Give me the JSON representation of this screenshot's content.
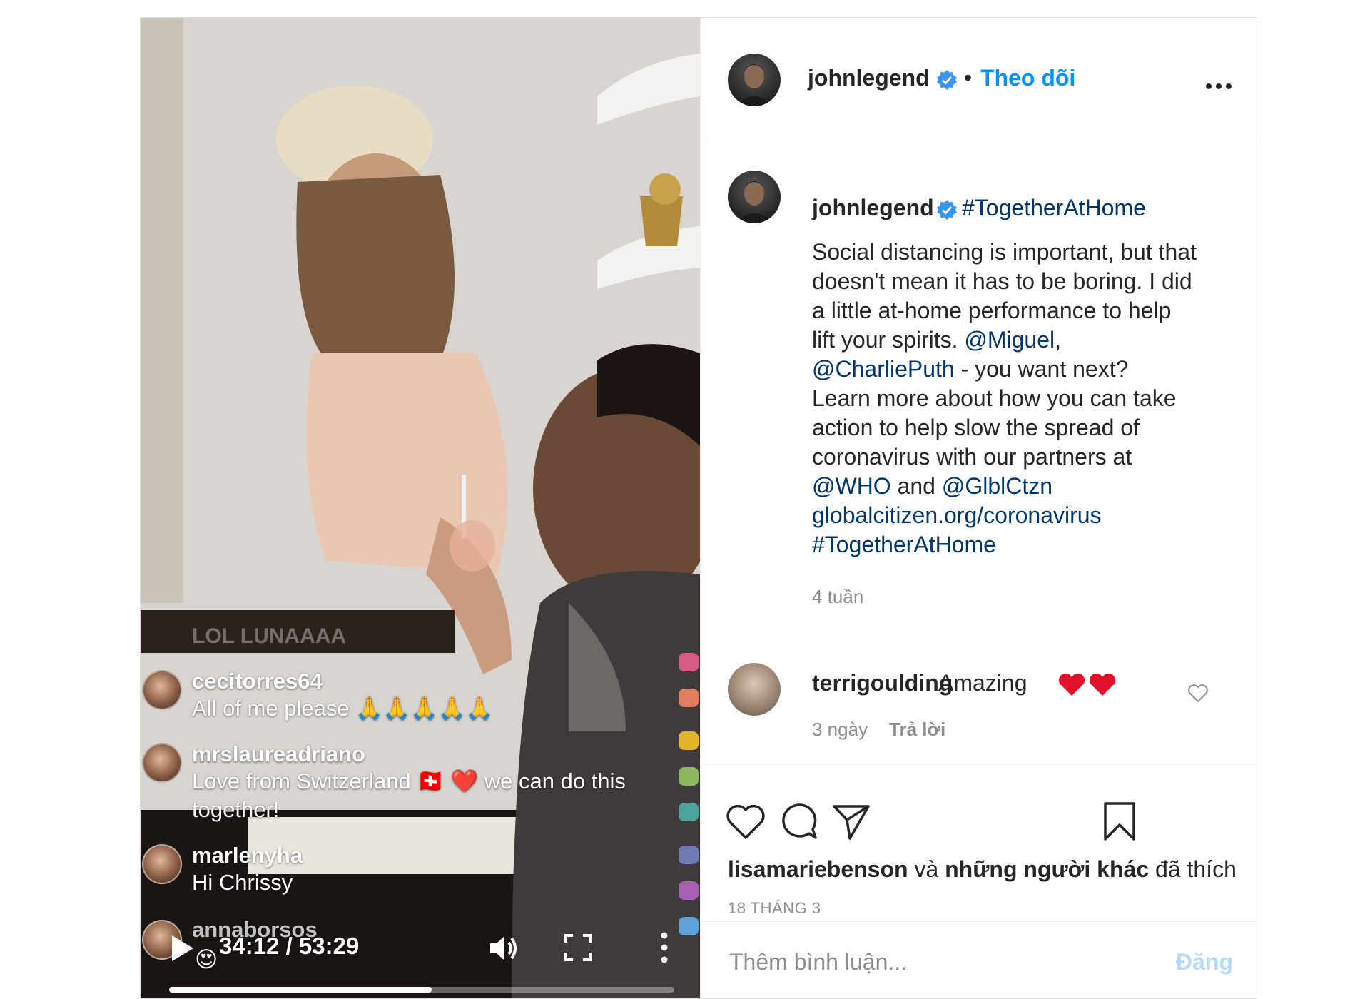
{
  "video": {
    "live_comments": [
      {
        "user": "",
        "text": "LOL LUNAAAA"
      },
      {
        "user": "cecitorres64",
        "text": "All of me please 🙏🙏🙏🙏🙏"
      },
      {
        "user": "mrslaureadriano",
        "text": "Love from Switzerland 🇨🇭 ❤️ we can do this together!"
      },
      {
        "user": "marlenyha",
        "text": "Hi Chrissy"
      },
      {
        "user": "annaborsos",
        "text": "😍"
      }
    ],
    "time": "34:12 / 53:29",
    "progress": 0.52
  },
  "header": {
    "username": "johnlegend",
    "separator": "•",
    "follow_label": "Theo dõi"
  },
  "caption": {
    "username": "johnlegend",
    "hashtag": "#TogetherAtHome",
    "lines": [
      [
        {
          "t": "Social distancing is important, but that"
        }
      ],
      [
        {
          "t": "doesn't mean it has to be boring. I did"
        }
      ],
      [
        {
          "t": "a little at-home performance to help"
        }
      ],
      [
        {
          "t": "lift your spirits. "
        },
        {
          "t": "@Miguel",
          "link": true
        },
        {
          "t": ","
        }
      ],
      [
        {
          "t": "@CharliePuth",
          "link": true
        },
        {
          "t": " - you want next?"
        }
      ],
      [
        {
          "t": "Learn more about how you can take"
        }
      ],
      [
        {
          "t": "action to help slow the spread of"
        }
      ],
      [
        {
          "t": "coronavirus with our partners at"
        }
      ],
      [
        {
          "t": "@WHO",
          "link": true
        },
        {
          "t": " and "
        },
        {
          "t": "@GlblCtzn",
          "link": true
        }
      ],
      [
        {
          "t": "globalcitizen.org/coronavirus",
          "link": true
        }
      ],
      [
        {
          "t": "#TogetherAtHome",
          "link": true
        }
      ]
    ],
    "time_ago": "4 tuần"
  },
  "comment": {
    "username": "terrigoulding",
    "text": "Amazing",
    "time": "3 ngày",
    "reply_label": "Trả lời"
  },
  "likes": {
    "user": "lisamariebenson",
    "conj": " và ",
    "others": "những người khác",
    "suffix": " đã thích"
  },
  "date": "18 THÁNG 3",
  "add_comment": {
    "placeholder": "Thêm bình luận...",
    "post_label": "Đăng"
  },
  "colors": {
    "link": "#00376b",
    "follow": "#0095f6",
    "verified": "#3897f0",
    "post_disabled": "#b3dbff",
    "heart_red": "#ed4956"
  }
}
